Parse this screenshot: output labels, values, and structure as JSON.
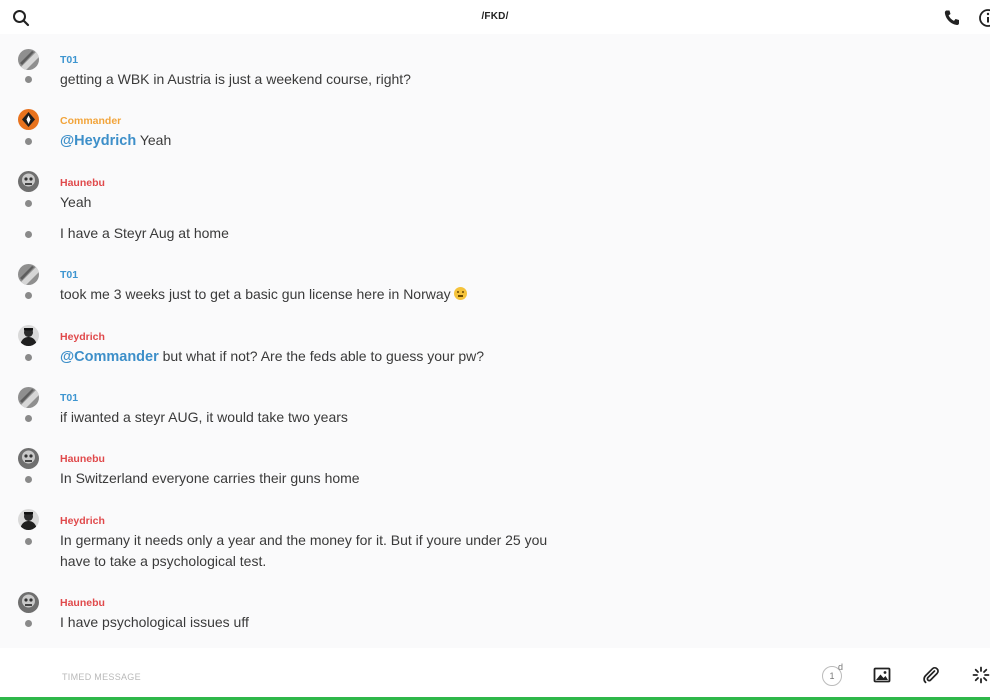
{
  "header": {
    "title": "/FKD/"
  },
  "colors": {
    "T01": "#3d95d0",
    "Commander": "#f2a43a",
    "Haunebu": "#e0494b",
    "Heydrich": "#e0494b",
    "mention": "#3d8fc9"
  },
  "messages": [
    {
      "author": "T01",
      "avatar": "t01",
      "lines": [
        {
          "text": "getting a WBK in Austria is just a weekend course, right?"
        }
      ]
    },
    {
      "author": "Commander",
      "avatar": "commander",
      "lines": [
        {
          "mention": "@Heydrich",
          "text": " Yeah"
        }
      ]
    },
    {
      "author": "Haunebu",
      "avatar": "haunebu",
      "lines": [
        {
          "text": "Yeah"
        },
        {
          "text": "I have a Steyr Aug at home"
        }
      ]
    },
    {
      "author": "T01",
      "avatar": "t01",
      "lines": [
        {
          "text": "took me 3 weeks just to get a basic gun license here in Norway",
          "emoji": "confused-face"
        }
      ]
    },
    {
      "author": "Heydrich",
      "avatar": "heydrich",
      "lines": [
        {
          "mention": "@Commander",
          "text": " but what if not? Are the feds able to guess your pw?"
        }
      ]
    },
    {
      "author": "T01",
      "avatar": "t01",
      "lines": [
        {
          "text": "if iwanted a steyr AUG, it would take two years"
        }
      ]
    },
    {
      "author": "Haunebu",
      "avatar": "haunebu",
      "lines": [
        {
          "text": "In Switzerland everyone carries their guns home"
        }
      ]
    },
    {
      "author": "Heydrich",
      "avatar": "heydrich",
      "lines": [
        {
          "text": "In germany it needs only a year and the money for it. But if youre under 25 you have to take a psychological test."
        }
      ]
    },
    {
      "author": "Haunebu",
      "avatar": "haunebu",
      "lines": [
        {
          "text": "I have psychological issues uff"
        }
      ]
    }
  ],
  "composer": {
    "placeholder": "TIMED MESSAGE",
    "timer_value": "1",
    "timer_unit": "d"
  }
}
